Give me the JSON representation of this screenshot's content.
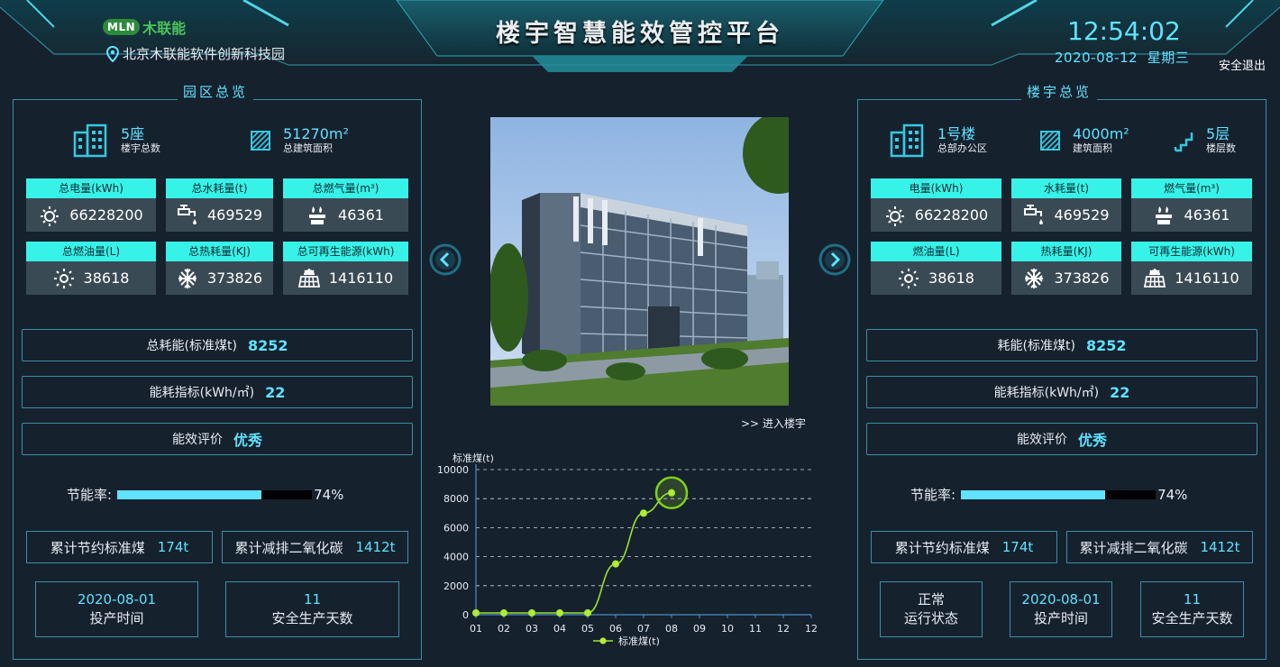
{
  "header": {
    "logo_badge": "MLN",
    "logo_text": "木联能",
    "park_name": "北京木联能软件创新科技园",
    "title": "楼宇智慧能效管控平台",
    "time": "12:54:02",
    "date": "2020-08-12",
    "weekday": "星期三",
    "logout": "安全退出"
  },
  "left": {
    "title": "园区总览",
    "stats": [
      {
        "value": "5座",
        "label": "楼宇总数",
        "icon": "building-icon"
      },
      {
        "value": "51270m²",
        "label": "总建筑面积",
        "icon": "area-icon"
      }
    ],
    "cards": [
      {
        "label": "总电量(kWh)",
        "value": "66228200",
        "icon": "electricity-icon"
      },
      {
        "label": "总水耗量(t)",
        "value": "469529",
        "icon": "water-tap-icon"
      },
      {
        "label": "总燃气量(m³)",
        "value": "46361",
        "icon": "gas-icon"
      },
      {
        "label": "总燃油量(L)",
        "value": "38618",
        "icon": "sun-icon"
      },
      {
        "label": "总热耗量(KJ)",
        "value": "373826",
        "icon": "snowflake-icon"
      },
      {
        "label": "总可再生能源(kWh)",
        "value": "1416110",
        "icon": "solar-panel-icon"
      }
    ],
    "total_energy": {
      "label": "总耗能(标准煤t)",
      "value": "8252"
    },
    "energy_index": {
      "label": "能耗指标(kWh/㎡)",
      "value": "22"
    },
    "evaluation": {
      "label": "能效评价",
      "value": "优秀"
    },
    "saving_rate": {
      "label": "节能率:",
      "percent": 74,
      "display": "74%"
    },
    "saved_coal": {
      "label": "累计节约标准煤",
      "value": "174t"
    },
    "co2_reduced": {
      "label": "累计减排二氧化碳",
      "value": "1412t"
    },
    "commission": {
      "value": "2020-08-01",
      "label": "投产时间"
    },
    "safe_days": {
      "value": "11",
      "label": "安全生产天数"
    }
  },
  "right": {
    "title": "楼宇总览",
    "stats": [
      {
        "value": "1号楼",
        "label": "总部办公区",
        "icon": "building-icon"
      },
      {
        "value": "4000m²",
        "label": "建筑面积",
        "icon": "area-icon"
      },
      {
        "value": "5层",
        "label": "楼层数",
        "icon": "stairs-icon"
      }
    ],
    "cards": [
      {
        "label": "电量(kWh)",
        "value": "66228200",
        "icon": "electricity-icon"
      },
      {
        "label": "水耗量(t)",
        "value": "469529",
        "icon": "water-tap-icon"
      },
      {
        "label": "燃气量(m³)",
        "value": "46361",
        "icon": "gas-icon"
      },
      {
        "label": "燃油量(L)",
        "value": "38618",
        "icon": "sun-icon"
      },
      {
        "label": "热耗量(KJ)",
        "value": "373826",
        "icon": "snowflake-icon"
      },
      {
        "label": "可再生能源(kWh)",
        "value": "1416110",
        "icon": "solar-panel-icon"
      }
    ],
    "total_energy": {
      "label": "耗能(标准煤t)",
      "value": "8252"
    },
    "energy_index": {
      "label": "能耗指标(kWh/㎡)",
      "value": "22"
    },
    "evaluation": {
      "label": "能效评价",
      "value": "优秀"
    },
    "saving_rate": {
      "label": "节能率:",
      "percent": 74,
      "display": "74%"
    },
    "saved_coal": {
      "label": "累计节约标准煤",
      "value": "174t"
    },
    "co2_reduced": {
      "label": "累计减排二氧化碳",
      "value": "1412t"
    },
    "status": {
      "value": "正常",
      "label": "运行状态"
    },
    "commission": {
      "value": "2020-08-01",
      "label": "投产时间"
    },
    "safe_days": {
      "value": "11",
      "label": "安全生产天数"
    }
  },
  "center": {
    "enter_link": ">> 进入楼宇"
  },
  "colors": {
    "accent": "#5fe3ff",
    "card_header": "#37f2e7",
    "panel_border": "#3a8fa8",
    "line": "#9be330",
    "background": "#16212e"
  },
  "chart_data": {
    "type": "line",
    "title": "",
    "ylabel": "标准煤(t)",
    "xlabel": "",
    "categories": [
      "01",
      "02",
      "03",
      "04",
      "05",
      "06",
      "07",
      "08",
      "09",
      "10",
      "11",
      "12"
    ],
    "series": [
      {
        "name": "标准煤(t)",
        "values": [
          0,
          0,
          0,
          0,
          0,
          3500,
          7000,
          8400
        ]
      }
    ],
    "ylim": [
      0,
      10000
    ],
    "yticks": [
      0,
      2000,
      4000,
      6000,
      8000,
      10000
    ],
    "grid": "horizontal-dashed",
    "legend": "bottom-center",
    "highlight_index": 7
  }
}
